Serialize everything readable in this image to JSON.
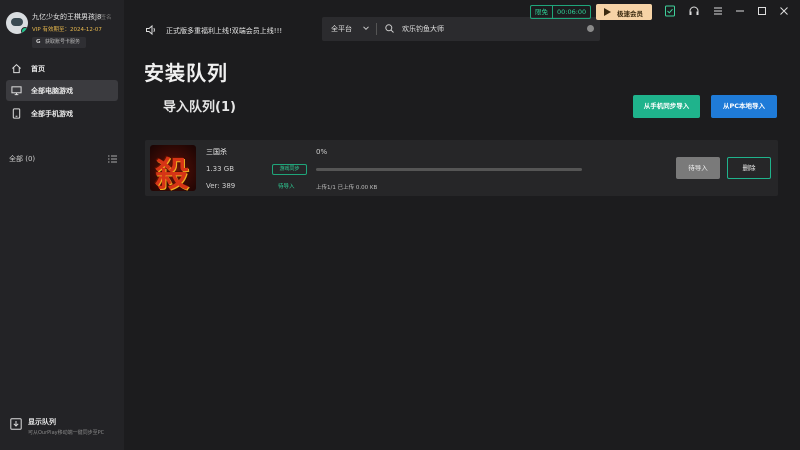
{
  "user": {
    "name": "九亿少女的王棋男孩j8",
    "tag": "已签名",
    "vip_label": "VIP 有效期至：2024-12-07",
    "get_vip_label": "获取账号卡服务"
  },
  "sidebar": {
    "items": [
      {
        "label": "首页",
        "icon": "home-icon"
      },
      {
        "label": "全部电脑游戏",
        "icon": "monitor-icon",
        "active": true
      },
      {
        "label": "全部手机游戏",
        "icon": "phone-icon"
      }
    ],
    "all_label": "全部 (0)",
    "queue_title": "显示队列",
    "queue_desc": "可从OurPlay移动端一键同步至PC"
  },
  "topbar": {
    "notice": "正式版多重福利上线!双端会员上线!!!",
    "platform": "全平台",
    "search_value": "欢乐钓鱼大师",
    "speed_label": "限免",
    "speed_time": "00:06:00",
    "vip_button": "极速会员"
  },
  "main": {
    "title": "安装队列",
    "section_title": "导入队列(1)",
    "sync_from_phone": "从手机同步导入",
    "import_from_pc": "从PC本地导入"
  },
  "queue": [
    {
      "name": "三国杀",
      "size": "1.33 GB",
      "version": "Ver: 389",
      "sync_tag": "游戏同步",
      "status": "待导入",
      "progress_label": "0%",
      "progress": 0,
      "upload_info": "上传1/1 已上传 0.00 KB",
      "wait_button": "待导入",
      "delete_button": "删除",
      "thumb_glyph": "殺"
    }
  ],
  "colors": {
    "accent_green": "#1fb38c",
    "accent_blue": "#1f7bd8",
    "vip_gold": "#f6d3a6",
    "background": "#1c1c1e"
  }
}
